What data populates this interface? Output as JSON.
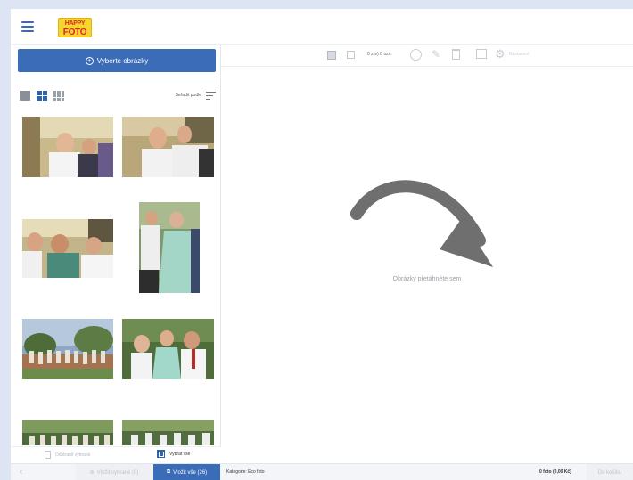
{
  "header": {
    "logo_line1": "HAPPY",
    "logo_line2": "FOTO"
  },
  "sidebar": {
    "select_button_label": "Vyberte obrázky",
    "sort_label": "Seřadit podle",
    "delete_selected_label": "Odstranit vybrané",
    "select_all_label": "Vybrat vše",
    "view_modes": [
      "single",
      "grid-2",
      "grid-3"
    ],
    "active_view": "grid-2",
    "photo_count": 8
  },
  "toolbar": {
    "count_label": "0 z(e) 0 ozn.",
    "settings_label": "Nastavení"
  },
  "main": {
    "drop_text": "Obrázky přetáhněte sem"
  },
  "footer": {
    "back_label": "‹",
    "insert_selected_label": "Vložit vybrané (0)",
    "insert_all_label": "Vložit vše (26)",
    "category_label": "Kategorie: Eco foto",
    "photo_count_label": "0 foto (0,00 Kč)",
    "cart_label": "Do košíku"
  },
  "colors": {
    "accent": "#3b6cb7",
    "page_background": "#dde4f3",
    "logo_yellow": "#f8d431",
    "logo_red": "#d42a1e"
  }
}
